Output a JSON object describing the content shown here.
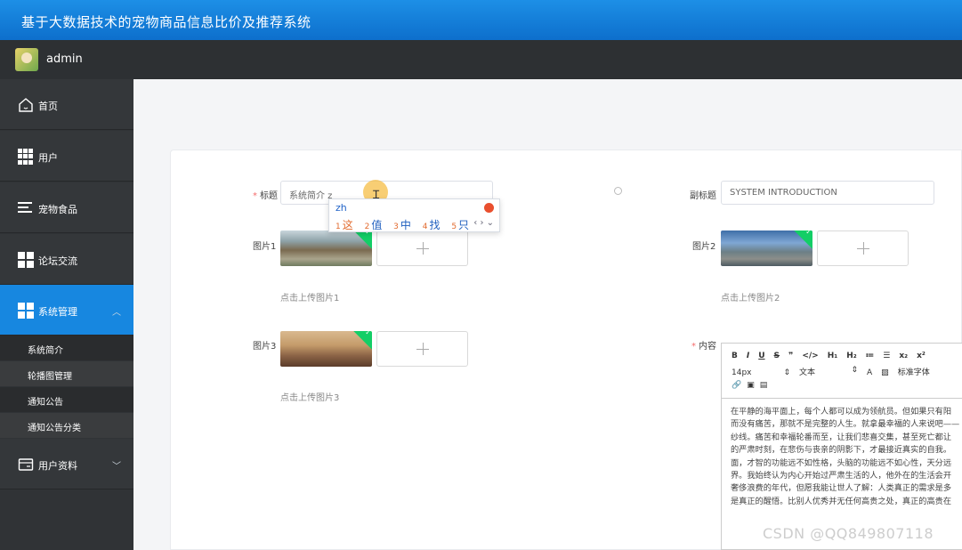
{
  "header": {
    "title": "基于大数据技术的宠物商品信息比价及推荐系统"
  },
  "user": {
    "name": "admin"
  },
  "sidebar": {
    "items": [
      {
        "label": "首页",
        "icon": "home-icon"
      },
      {
        "label": "用户",
        "icon": "grid-icon"
      },
      {
        "label": "宠物食品",
        "icon": "list-icon"
      },
      {
        "label": "论坛交流",
        "icon": "grid-icon"
      },
      {
        "label": "系统管理",
        "icon": "grid-icon"
      },
      {
        "label": "用户资料",
        "icon": "card-icon"
      }
    ],
    "sub_items": [
      "系统简介",
      "轮播图管理",
      "通知公告",
      "通知公告分类"
    ]
  },
  "form": {
    "title_label": "标题",
    "title_value": "系统简介 z",
    "subtitle_label": "副标题",
    "subtitle_value": "SYSTEM INTRODUCTION",
    "image1_label": "图片1",
    "image1_hint": "点击上传图片1",
    "image2_label": "图片2",
    "image2_hint": "点击上传图片2",
    "image3_label": "图片3",
    "image3_hint": "点击上传图片3",
    "content_label": "内容"
  },
  "ime": {
    "composition": "zh",
    "candidates": [
      {
        "num": "1",
        "text": "这"
      },
      {
        "num": "2",
        "text": "值"
      },
      {
        "num": "3",
        "text": "中"
      },
      {
        "num": "4",
        "text": "找"
      },
      {
        "num": "5",
        "text": "只"
      }
    ],
    "nav": "‹ › ⌄"
  },
  "editor": {
    "toolbar_row1": [
      "B",
      "I",
      "U",
      "S",
      "❞",
      "</>",
      "H₁",
      "H₂",
      "≔",
      "☰",
      "x₂",
      "x²"
    ],
    "font_size": "14px",
    "text_style": "文本",
    "font_family": "标准字体",
    "content_lines": [
      "在平静的海平面上，每个人都可以成为领航员。但如果只有阳",
      "而没有痛苦，那就不是完整的人生。就拿最幸福的人来说吧——",
      "纱线。痛苦和幸福轮番而至，让我们悲喜交集，甚至死亡都让",
      "的严肃时刻，在悲伤与丧亲的阴影下，才最接近真实的自我。",
      "面，才智的功能远不如性格，头脑的功能远不如心性，天分远",
      "界。我始终认为内心开始过严肃生活的人，他外在的生活会开",
      "奢侈浪费的年代，但愿我能让世人了解：人类真正的需求是多",
      "是真正的醒悟。比别人优秀并无任何高贵之处，真正的高贵在"
    ]
  },
  "watermark": "CSDN @QQ849807118"
}
